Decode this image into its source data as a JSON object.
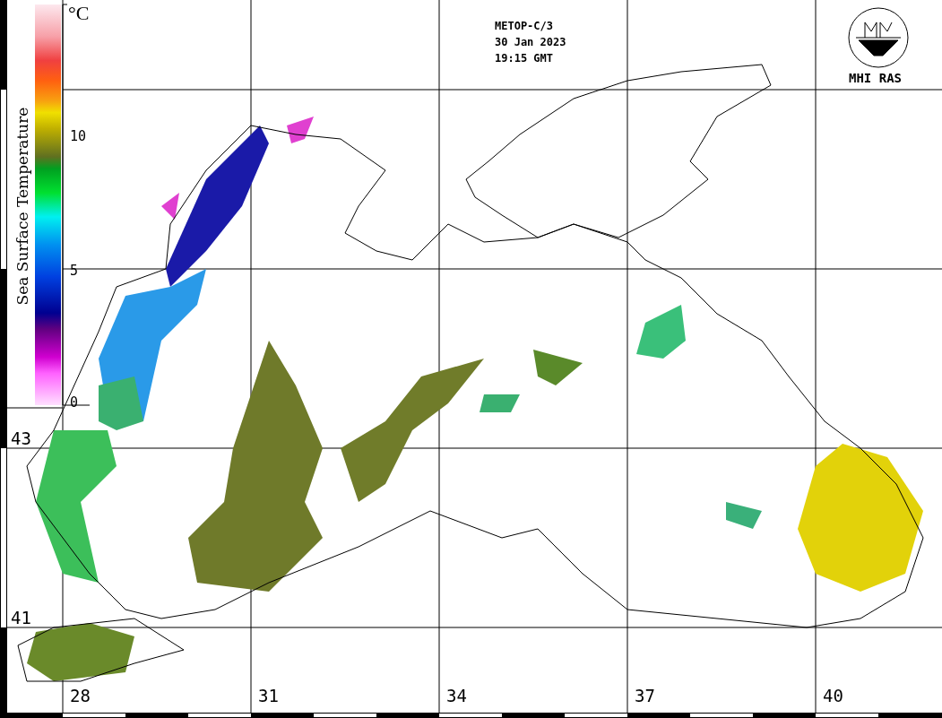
{
  "header": {
    "lines": [
      "METOP-C/3",
      "30 Jan 2023",
      "19:15 GMT"
    ]
  },
  "logo": {
    "caption": "MHI RAS"
  },
  "colorbar": {
    "title": "Sea Surface Temperature",
    "unit": "°C",
    "ticks": [
      "10",
      "5",
      "0"
    ]
  },
  "map": {
    "longitudes": [
      "28",
      "31",
      "34",
      "37",
      "40"
    ],
    "latitudes": [
      "43",
      "41"
    ]
  }
}
